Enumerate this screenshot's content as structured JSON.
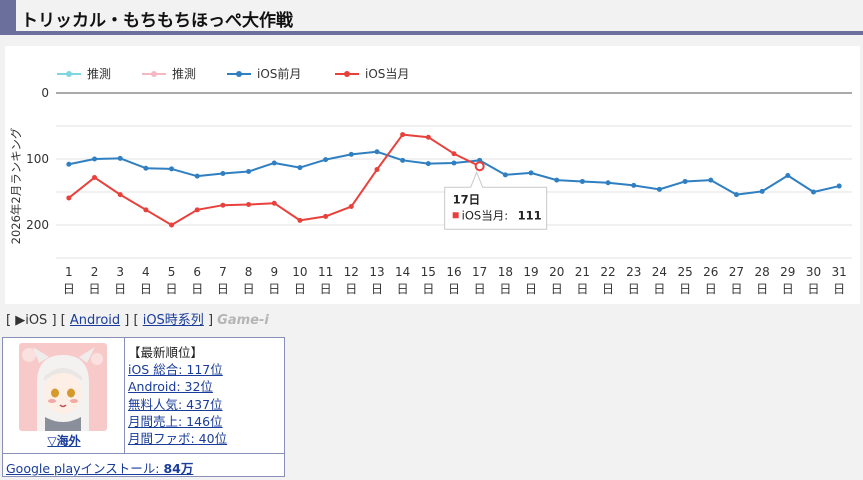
{
  "page": {
    "title": "トリッカル・もちもちほっぺ大作戦"
  },
  "chart_data": {
    "type": "line",
    "ylabel": "2026年2月ランキング",
    "ylim": [
      0,
      250
    ],
    "y_reversed": true,
    "yticks": [
      0,
      100,
      200
    ],
    "categories": [
      "1日",
      "2日",
      "3日",
      "4日",
      "5日",
      "6日",
      "7日",
      "8日",
      "9日",
      "10日",
      "11日",
      "12日",
      "13日",
      "14日",
      "15日",
      "16日",
      "17日",
      "18日",
      "19日",
      "20日",
      "21日",
      "22日",
      "23日",
      "24日",
      "25日",
      "26日",
      "27日",
      "28日",
      "29日",
      "30日",
      "31日"
    ],
    "legend": [
      {
        "name": "推測",
        "color": "#7fd6e0"
      },
      {
        "name": "推測",
        "color": "#f5b8c3"
      },
      {
        "name": "iOS前月",
        "color": "#2f7fc1"
      },
      {
        "name": "iOS当月",
        "color": "#e8413c"
      }
    ],
    "series": [
      {
        "name": "iOS前月",
        "color": "#2f7fc1",
        "values": [
          108,
          100,
          99,
          114,
          115,
          126,
          122,
          119,
          106,
          113,
          101,
          93,
          89,
          102,
          107,
          106,
          102,
          124,
          121,
          132,
          134,
          136,
          140,
          146,
          134,
          132,
          154,
          149,
          125,
          150,
          141
        ]
      },
      {
        "name": "iOS当月",
        "color": "#e8413c",
        "values": [
          159,
          128,
          154,
          177,
          200,
          177,
          170,
          169,
          167,
          193,
          187,
          172,
          116,
          63,
          67,
          92,
          111
        ]
      }
    ],
    "tooltip": {
      "title": "17日",
      "series": "iOS当月",
      "value": "111"
    }
  },
  "nav": {
    "open": "[",
    "sep1": "] [",
    "sep2": "] [",
    "close": "]",
    "current": "▶iOS",
    "android": "Android",
    "ios_series": "iOS時系列",
    "game_i": "Game-i"
  },
  "info": {
    "region": "▽海外",
    "heading": "【最新順位】",
    "ranks": [
      "iOS 総合: 117位",
      "Android: 32位",
      "無料人気: 437位",
      "月間売上: 146位",
      "月間ファボ: 40位"
    ],
    "install_prefix": "Google playインストール: ",
    "install_value": "84万"
  }
}
